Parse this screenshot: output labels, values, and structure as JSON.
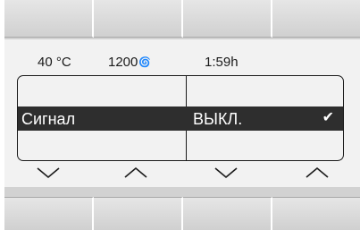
{
  "status": {
    "temperature": "40 °C",
    "power": "1200",
    "power_icon": "spiral-icon",
    "time": "1:59h"
  },
  "selection": {
    "label": "Сигнал",
    "value": "ВЫКЛ.",
    "check_icon": "checkmark-icon"
  },
  "arrows": [
    "chevron-down-icon",
    "chevron-up-icon",
    "chevron-down-icon",
    "chevron-up-icon"
  ],
  "colors": {
    "selection_bg": "#2e2e2e",
    "panel_bg": "#f2f2f2",
    "button_bg": "#dcdcdc"
  }
}
